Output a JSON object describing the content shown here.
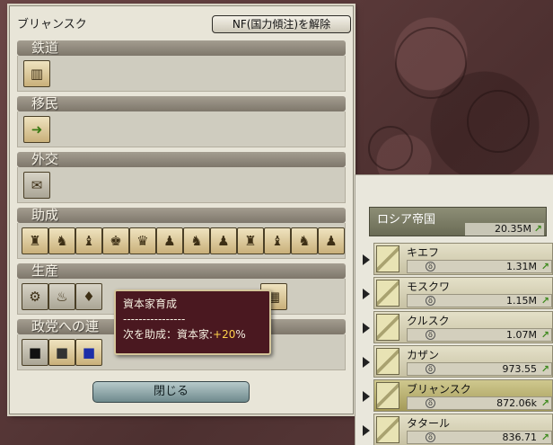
{
  "panel": {
    "title": "ブリャンスク",
    "nf_button_label": "NF(国力傾注)を解除",
    "close_label": "閉じる"
  },
  "categories": [
    {
      "label": "鉄道",
      "icons": [
        "rail-icon"
      ]
    },
    {
      "label": "移民",
      "icons": [
        "migration-icon"
      ]
    },
    {
      "label": "外交",
      "icons": [
        "diplomacy-icon"
      ]
    },
    {
      "label": "助成",
      "icons": [
        "pop-aristocrat-icon",
        "pop-artisan-icon",
        "pop-bureaucrat-icon",
        "pop-capitalist-icon",
        "pop-clergy-icon",
        "pop-clerk-icon",
        "pop-craftsman-icon",
        "pop-farmer-icon",
        "pop-labourer-icon",
        "pop-officer-icon",
        "pop-soldier-icon",
        "pop-serf-icon"
      ]
    },
    {
      "label": "生産",
      "icons": [
        "factory-icon",
        "oil-icon",
        "liquor-icon"
      ]
    },
    {
      "label": "政党への連",
      "icons": [
        "party-black-icon",
        "party-grey-icon",
        "party-blue-icon"
      ]
    }
  ],
  "tooltip": {
    "title": "資本家育成",
    "divider": "----------------",
    "line_prefix": "次を助成：資本家:",
    "line_value": "+20",
    "line_suffix": "%"
  },
  "empire": {
    "name": "ロシア帝国",
    "value": "20.35M"
  },
  "regions": [
    {
      "name": "キエフ",
      "value": "1.31M",
      "selected": false
    },
    {
      "name": "モスクワ",
      "value": "1.15M",
      "selected": false
    },
    {
      "name": "クルスク",
      "value": "1.07M",
      "selected": false
    },
    {
      "name": "カザン",
      "value": "973.55",
      "selected": false
    },
    {
      "name": "ブリャンスク",
      "value": "872.06k",
      "selected": true
    },
    {
      "name": "タタール",
      "value": "836.71",
      "selected": false
    }
  ]
}
